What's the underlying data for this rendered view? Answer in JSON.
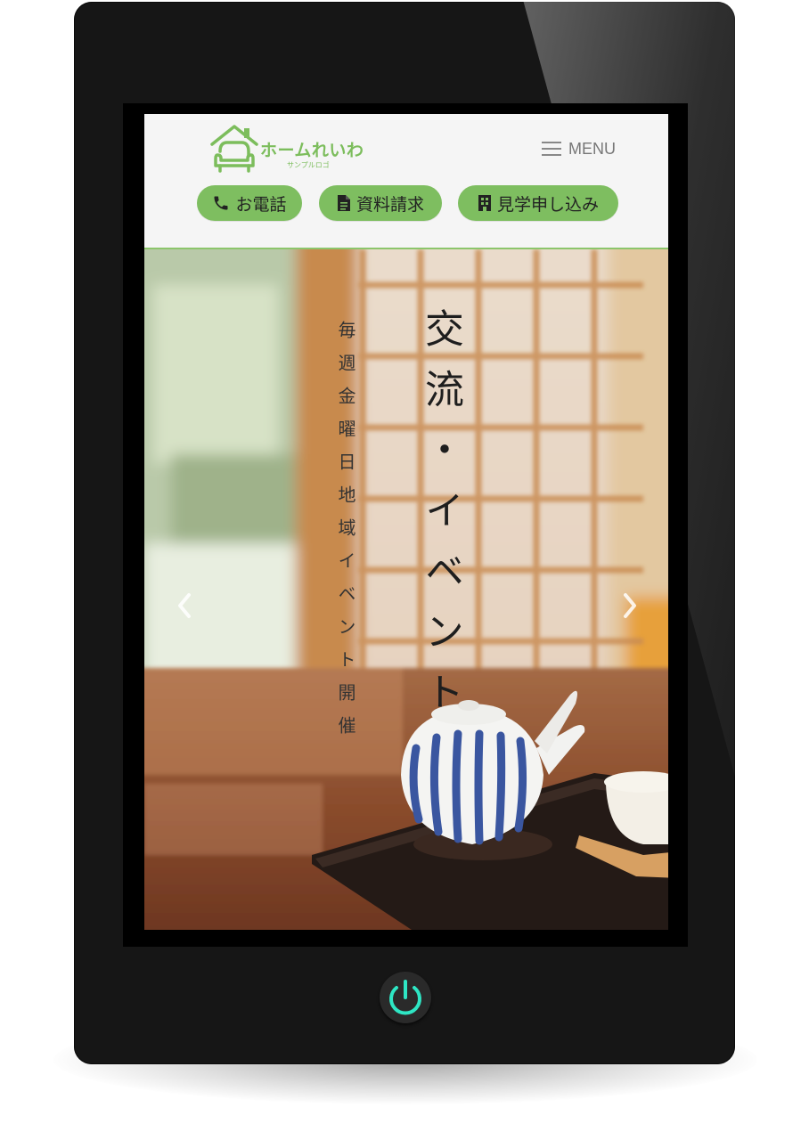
{
  "colors": {
    "brand_green": "#7ebe60",
    "logo_green": "#7cbd5c",
    "tablet_body": "#161616",
    "power_glow": "#2ee6c4"
  },
  "header": {
    "logo_text": "ホームれいわ",
    "logo_subtext": "サンプルロゴ",
    "menu_label": "MENU",
    "buttons": [
      {
        "label": "お電話",
        "icon": "phone-icon"
      },
      {
        "label": "資料請求",
        "icon": "document-icon"
      },
      {
        "label": "見学申し込み",
        "icon": "building-icon"
      }
    ]
  },
  "hero": {
    "title": "交流・イベント",
    "subtitle": "毎週金曜日地域イベント開催",
    "prev_icon": "chevron-left-icon",
    "next_icon": "chevron-right-icon"
  },
  "device": {
    "power_icon": "power-icon"
  }
}
